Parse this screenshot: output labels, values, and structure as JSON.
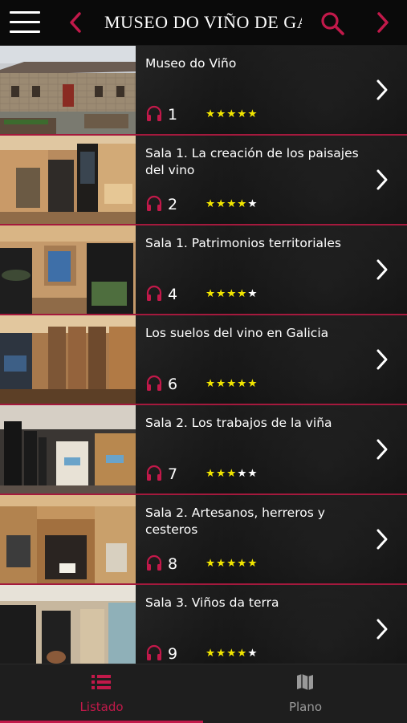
{
  "header": {
    "title": "MUSEO DO VIÑO DE GALICIA",
    "menu_icon": "hamburger-icon",
    "prev_icon": "chevron-left-icon",
    "next_icon": "chevron-right-icon",
    "search_icon": "search-icon",
    "accent_color": "#c2194a"
  },
  "items": [
    {
      "title": "Museo do Viño",
      "number": "1",
      "rating": 5
    },
    {
      "title": "Sala 1. La creación de los paisajes del vino",
      "number": "2",
      "rating": 4
    },
    {
      "title": "Sala 1. Patrimonios territoriales",
      "number": "4",
      "rating": 4
    },
    {
      "title": "Los suelos del vino en Galicia",
      "number": "6",
      "rating": 5
    },
    {
      "title": "Sala 2. Los trabajos de la viña",
      "number": "7",
      "rating": 3
    },
    {
      "title": "Sala 2. Artesanos, herreros y cesteros",
      "number": "8",
      "rating": 5
    },
    {
      "title": "Sala 3. Viños da terra",
      "number": "9",
      "rating": 4
    }
  ],
  "tabs": [
    {
      "label": "Listado",
      "icon": "list-icon",
      "active": true
    },
    {
      "label": "Plano",
      "icon": "map-icon",
      "active": false
    }
  ],
  "colors": {
    "star_on": "#f2e600",
    "star_off": "#ffffff",
    "separator": "#a4193d"
  }
}
